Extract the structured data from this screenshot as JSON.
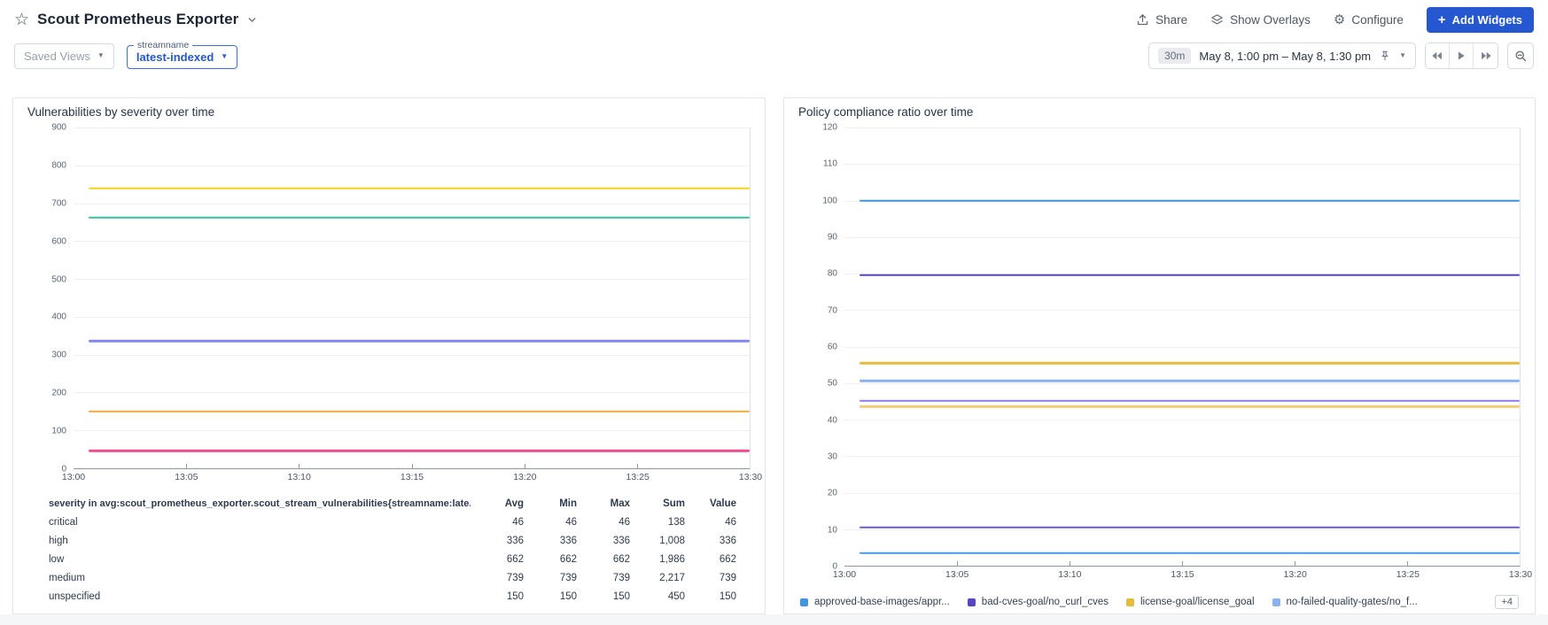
{
  "header": {
    "title": "Scout Prometheus Exporter",
    "actions": {
      "share": "Share",
      "show_overlays": "Show Overlays",
      "configure": "Configure",
      "add_widgets": "Add Widgets"
    }
  },
  "controls": {
    "saved_views": "Saved Views",
    "streamname_label": "streamname",
    "streamname_value": "latest-indexed",
    "time_range": {
      "duration": "30m",
      "range": "May 8, 1:00 pm – May 8, 1:30 pm"
    }
  },
  "icons": {
    "star": "☆",
    "gear": "⚙",
    "plus": "+",
    "caret_down": "▼"
  },
  "colors": {
    "accent_blue": "#2457d0",
    "critical": "#ee4c8f",
    "high": "#8186f2",
    "low": "#30c39a",
    "medium": "#f7d516",
    "unspecified": "#f4a93c"
  },
  "chart_data": [
    {
      "type": "line",
      "title": "Vulnerabilities by severity over time",
      "ylim": [
        0,
        900
      ],
      "ytick_step": 100,
      "grid": true,
      "x_ticks": [
        "13:00",
        "13:05",
        "13:10",
        "13:15",
        "13:20",
        "13:25",
        "13:30"
      ],
      "series": [
        {
          "label": "critical",
          "color": "#ee4c8f",
          "value": 46,
          "in_legend": true
        },
        {
          "label": "high",
          "color": "#8186f2",
          "value": 336,
          "in_legend": true
        },
        {
          "label": "low",
          "color": "#30c39a",
          "value": 662,
          "in_legend": true
        },
        {
          "label": "medium",
          "color": "#f7d516",
          "value": 739,
          "in_legend": true
        },
        {
          "label": "unspecified",
          "color": "#f4a93c",
          "value": 150,
          "in_legend": true
        }
      ],
      "legend_table": {
        "metric_header": "severity in avg:scout_prometheus_exporter.scout_stream_vulnerabilities{streamname:late...",
        "columns": [
          "Avg",
          "Min",
          "Max",
          "Sum",
          "Value"
        ],
        "rows": [
          {
            "label": "critical",
            "color": "#ee4c8f",
            "values": [
              "46",
              "46",
              "46",
              "138",
              "46"
            ]
          },
          {
            "label": "high",
            "color": "#8186f2",
            "values": [
              "336",
              "336",
              "336",
              "1,008",
              "336"
            ]
          },
          {
            "label": "low",
            "color": "#30c39a",
            "values": [
              "662",
              "662",
              "662",
              "1,986",
              "662"
            ]
          },
          {
            "label": "medium",
            "color": "#f7d516",
            "values": [
              "739",
              "739",
              "739",
              "2,217",
              "739"
            ]
          },
          {
            "label": "unspecified",
            "color": "#f4a93c",
            "values": [
              "150",
              "150",
              "150",
              "450",
              "150"
            ]
          }
        ]
      }
    },
    {
      "type": "line",
      "title": "Policy compliance ratio over time",
      "ylim": [
        0,
        120
      ],
      "ytick_step": 10,
      "grid": true,
      "x_ticks": [
        "13:00",
        "13:05",
        "13:10",
        "13:15",
        "13:20",
        "13:25",
        "13:30"
      ],
      "series": [
        {
          "label": "approved-base-images/appr...",
          "color": "#3c96e5",
          "value": 100,
          "in_legend": true
        },
        {
          "label": "bad-cves-goal/no_curl_cves",
          "color": "#5b45c0",
          "value": 79.6,
          "in_legend": true
        },
        {
          "label": "license-goal/license_goal",
          "color": "#e7bb3a",
          "value": 55.4,
          "in_legend": true
        },
        {
          "label": "no-failed-quality-gates/no_f...",
          "color": "#8cb0f0",
          "value": 50.6,
          "in_legend": true
        },
        {
          "color": "#8d7cf0",
          "value": 45.1,
          "in_legend": false
        },
        {
          "color": "#f2cc75",
          "value": 43.6,
          "in_legend": false
        },
        {
          "color": "#7153d8",
          "value": 10.5,
          "in_legend": false
        },
        {
          "color": "#429af0",
          "value": 3.5,
          "in_legend": false
        }
      ],
      "legend_more": "+4"
    }
  ]
}
